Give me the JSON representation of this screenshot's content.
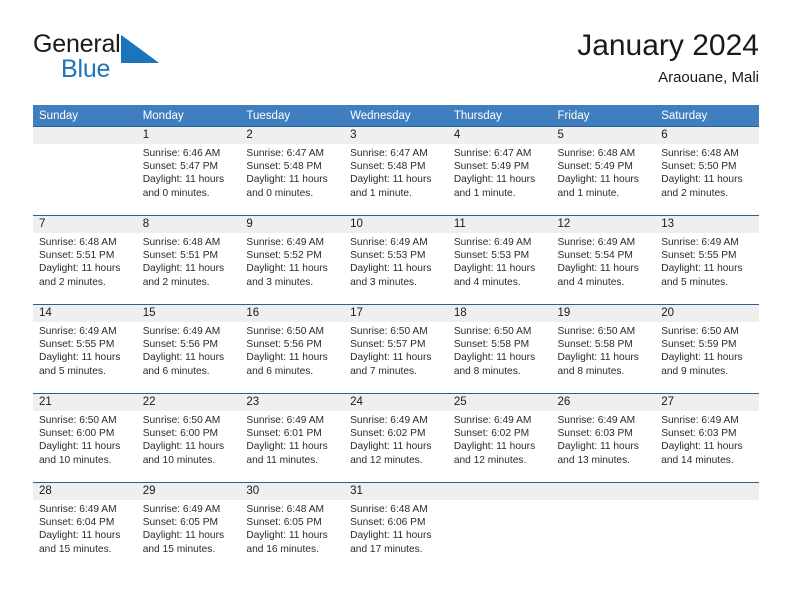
{
  "brand": {
    "name_top": "General",
    "name_bottom": "Blue",
    "flag_icon": "flag-triangle-icon",
    "accent_color": "#1b75bc"
  },
  "header": {
    "title": "January 2024",
    "subtitle": "Araouane, Mali"
  },
  "calendar": {
    "header_bg": "#3f7fbf",
    "row_border_color": "#2a6099",
    "daynum_band_bg": "#efefef",
    "weekdays": [
      "Sunday",
      "Monday",
      "Tuesday",
      "Wednesday",
      "Thursday",
      "Friday",
      "Saturday"
    ],
    "weeks": [
      [
        {
          "day": "",
          "sunrise": "",
          "sunset": "",
          "daylight": ""
        },
        {
          "day": "1",
          "sunrise": "Sunrise: 6:46 AM",
          "sunset": "Sunset: 5:47 PM",
          "daylight": "Daylight: 11 hours and 0 minutes."
        },
        {
          "day": "2",
          "sunrise": "Sunrise: 6:47 AM",
          "sunset": "Sunset: 5:48 PM",
          "daylight": "Daylight: 11 hours and 0 minutes."
        },
        {
          "day": "3",
          "sunrise": "Sunrise: 6:47 AM",
          "sunset": "Sunset: 5:48 PM",
          "daylight": "Daylight: 11 hours and 1 minute."
        },
        {
          "day": "4",
          "sunrise": "Sunrise: 6:47 AM",
          "sunset": "Sunset: 5:49 PM",
          "daylight": "Daylight: 11 hours and 1 minute."
        },
        {
          "day": "5",
          "sunrise": "Sunrise: 6:48 AM",
          "sunset": "Sunset: 5:49 PM",
          "daylight": "Daylight: 11 hours and 1 minute."
        },
        {
          "day": "6",
          "sunrise": "Sunrise: 6:48 AM",
          "sunset": "Sunset: 5:50 PM",
          "daylight": "Daylight: 11 hours and 2 minutes."
        }
      ],
      [
        {
          "day": "7",
          "sunrise": "Sunrise: 6:48 AM",
          "sunset": "Sunset: 5:51 PM",
          "daylight": "Daylight: 11 hours and 2 minutes."
        },
        {
          "day": "8",
          "sunrise": "Sunrise: 6:48 AM",
          "sunset": "Sunset: 5:51 PM",
          "daylight": "Daylight: 11 hours and 2 minutes."
        },
        {
          "day": "9",
          "sunrise": "Sunrise: 6:49 AM",
          "sunset": "Sunset: 5:52 PM",
          "daylight": "Daylight: 11 hours and 3 minutes."
        },
        {
          "day": "10",
          "sunrise": "Sunrise: 6:49 AM",
          "sunset": "Sunset: 5:53 PM",
          "daylight": "Daylight: 11 hours and 3 minutes."
        },
        {
          "day": "11",
          "sunrise": "Sunrise: 6:49 AM",
          "sunset": "Sunset: 5:53 PM",
          "daylight": "Daylight: 11 hours and 4 minutes."
        },
        {
          "day": "12",
          "sunrise": "Sunrise: 6:49 AM",
          "sunset": "Sunset: 5:54 PM",
          "daylight": "Daylight: 11 hours and 4 minutes."
        },
        {
          "day": "13",
          "sunrise": "Sunrise: 6:49 AM",
          "sunset": "Sunset: 5:55 PM",
          "daylight": "Daylight: 11 hours and 5 minutes."
        }
      ],
      [
        {
          "day": "14",
          "sunrise": "Sunrise: 6:49 AM",
          "sunset": "Sunset: 5:55 PM",
          "daylight": "Daylight: 11 hours and 5 minutes."
        },
        {
          "day": "15",
          "sunrise": "Sunrise: 6:49 AM",
          "sunset": "Sunset: 5:56 PM",
          "daylight": "Daylight: 11 hours and 6 minutes."
        },
        {
          "day": "16",
          "sunrise": "Sunrise: 6:50 AM",
          "sunset": "Sunset: 5:56 PM",
          "daylight": "Daylight: 11 hours and 6 minutes."
        },
        {
          "day": "17",
          "sunrise": "Sunrise: 6:50 AM",
          "sunset": "Sunset: 5:57 PM",
          "daylight": "Daylight: 11 hours and 7 minutes."
        },
        {
          "day": "18",
          "sunrise": "Sunrise: 6:50 AM",
          "sunset": "Sunset: 5:58 PM",
          "daylight": "Daylight: 11 hours and 8 minutes."
        },
        {
          "day": "19",
          "sunrise": "Sunrise: 6:50 AM",
          "sunset": "Sunset: 5:58 PM",
          "daylight": "Daylight: 11 hours and 8 minutes."
        },
        {
          "day": "20",
          "sunrise": "Sunrise: 6:50 AM",
          "sunset": "Sunset: 5:59 PM",
          "daylight": "Daylight: 11 hours and 9 minutes."
        }
      ],
      [
        {
          "day": "21",
          "sunrise": "Sunrise: 6:50 AM",
          "sunset": "Sunset: 6:00 PM",
          "daylight": "Daylight: 11 hours and 10 minutes."
        },
        {
          "day": "22",
          "sunrise": "Sunrise: 6:50 AM",
          "sunset": "Sunset: 6:00 PM",
          "daylight": "Daylight: 11 hours and 10 minutes."
        },
        {
          "day": "23",
          "sunrise": "Sunrise: 6:49 AM",
          "sunset": "Sunset: 6:01 PM",
          "daylight": "Daylight: 11 hours and 11 minutes."
        },
        {
          "day": "24",
          "sunrise": "Sunrise: 6:49 AM",
          "sunset": "Sunset: 6:02 PM",
          "daylight": "Daylight: 11 hours and 12 minutes."
        },
        {
          "day": "25",
          "sunrise": "Sunrise: 6:49 AM",
          "sunset": "Sunset: 6:02 PM",
          "daylight": "Daylight: 11 hours and 12 minutes."
        },
        {
          "day": "26",
          "sunrise": "Sunrise: 6:49 AM",
          "sunset": "Sunset: 6:03 PM",
          "daylight": "Daylight: 11 hours and 13 minutes."
        },
        {
          "day": "27",
          "sunrise": "Sunrise: 6:49 AM",
          "sunset": "Sunset: 6:03 PM",
          "daylight": "Daylight: 11 hours and 14 minutes."
        }
      ],
      [
        {
          "day": "28",
          "sunrise": "Sunrise: 6:49 AM",
          "sunset": "Sunset: 6:04 PM",
          "daylight": "Daylight: 11 hours and 15 minutes."
        },
        {
          "day": "29",
          "sunrise": "Sunrise: 6:49 AM",
          "sunset": "Sunset: 6:05 PM",
          "daylight": "Daylight: 11 hours and 15 minutes."
        },
        {
          "day": "30",
          "sunrise": "Sunrise: 6:48 AM",
          "sunset": "Sunset: 6:05 PM",
          "daylight": "Daylight: 11 hours and 16 minutes."
        },
        {
          "day": "31",
          "sunrise": "Sunrise: 6:48 AM",
          "sunset": "Sunset: 6:06 PM",
          "daylight": "Daylight: 11 hours and 17 minutes."
        },
        {
          "day": "",
          "sunrise": "",
          "sunset": "",
          "daylight": ""
        },
        {
          "day": "",
          "sunrise": "",
          "sunset": "",
          "daylight": ""
        },
        {
          "day": "",
          "sunrise": "",
          "sunset": "",
          "daylight": ""
        }
      ]
    ]
  }
}
